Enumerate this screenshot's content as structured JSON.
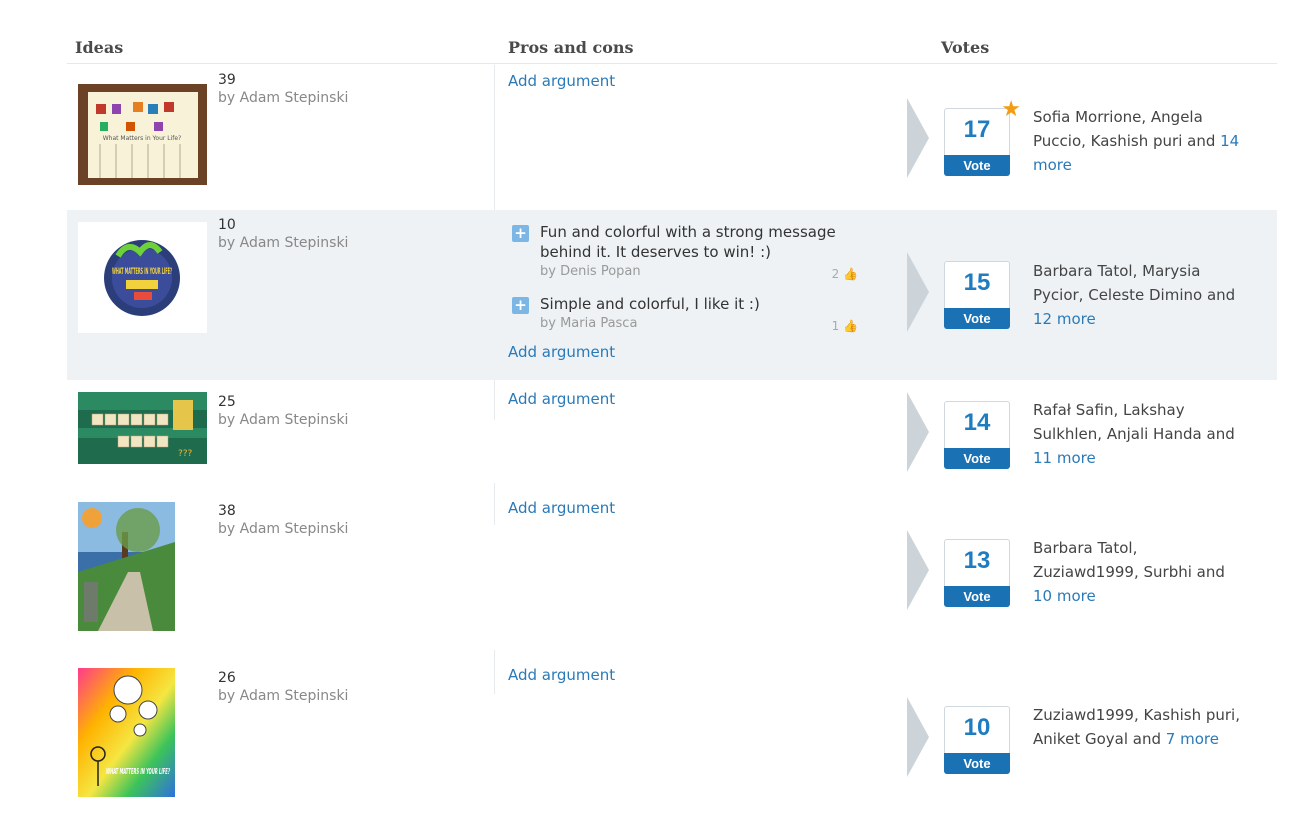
{
  "header": {
    "ideas": "Ideas",
    "pros_cons": "Pros and cons",
    "votes": "Votes"
  },
  "add_argument_label": "Add argument",
  "vote_label": "Vote",
  "ideas": [
    {
      "number": "39",
      "author": "by Adam Stepinski",
      "votes": "17",
      "top_voted": true,
      "voters_text": "Sofia Morrione, Angela Puccio, Kashish puri and",
      "more_text": "14 more",
      "arguments": []
    },
    {
      "number": "10",
      "author": "by Adam Stepinski",
      "votes": "15",
      "top_voted": false,
      "voters_text": "Barbara Tatol, Marysia Pycior, Celeste Dimino and",
      "more_text": "12 more",
      "arguments": [
        {
          "text": "Fun and colorful with a strong message behind it. It deserves to win! :)",
          "by": "by Denis Popan",
          "likes": "2"
        },
        {
          "text": "Simple and colorful, I like it :)",
          "by": "by Maria Pasca",
          "likes": "1"
        }
      ]
    },
    {
      "number": "25",
      "author": "by Adam Stepinski",
      "votes": "14",
      "top_voted": false,
      "voters_text": "Rafał Safin, Lakshay Sulkhlen, Anjali Handa and",
      "more_text": "11 more",
      "arguments": []
    },
    {
      "number": "38",
      "author": "by Adam Stepinski",
      "votes": "13",
      "top_voted": false,
      "voters_text": "Barbara Tatol, Zuziawd1999, Surbhi and",
      "more_text": "10 more",
      "arguments": []
    },
    {
      "number": "26",
      "author": "by Adam Stepinski",
      "votes": "10",
      "top_voted": false,
      "voters_text": "Zuziawd1999, Kashish puri, Aniket Goyal and",
      "more_text": "7 more",
      "arguments": []
    }
  ],
  "thumb_texts": {
    "thumb1": "What Matters in Your Life?",
    "thumb2": "WHAT MATTERS IN YOUR LIFE?",
    "thumb5": "WHAT MATTERS IN YOUR LIFE?"
  },
  "colors": {
    "link": "#2a7ab8",
    "vote_button": "#1a72b5",
    "vote_count": "#1f7cc0",
    "star": "#f39c12",
    "highlight_row": "#eef2f5"
  }
}
